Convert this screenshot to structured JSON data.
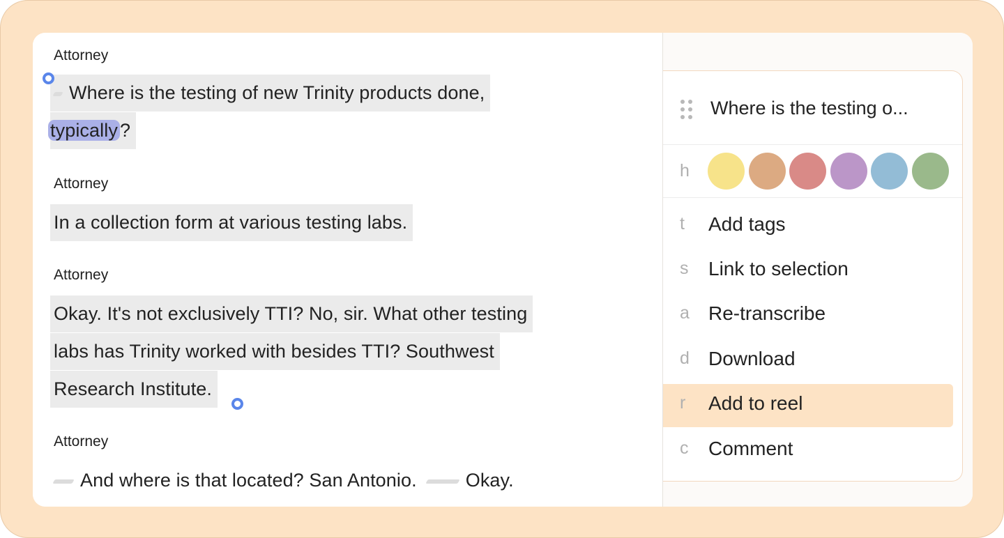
{
  "transcript": {
    "blocks": [
      {
        "speaker": "Attorney",
        "line1": "Where is the testing of new Trinity products done,",
        "highlight": "typically",
        "after_highlight": "?"
      },
      {
        "speaker": "Attorney",
        "line1": "In a collection form at various testing labs."
      },
      {
        "speaker": "Attorney",
        "line1": "Okay. It's not exclusively TTI? No, sir. What other testing",
        "line2": "labs has Trinity worked with besides TTI? Southwest",
        "line3": "Research Institute."
      },
      {
        "speaker": "Attorney",
        "part1": "And where is that located? San Antonio.",
        "part2": "Okay."
      }
    ]
  },
  "menu": {
    "title": "Where is the testing o...",
    "color_key": "h",
    "colors": [
      "#f7e38a",
      "#dcaa82",
      "#d98a87",
      "#bb96c8",
      "#93bcd6",
      "#9ab98b"
    ],
    "items": [
      {
        "key": "t",
        "label": "Add tags"
      },
      {
        "key": "s",
        "label": "Link to selection"
      },
      {
        "key": "a",
        "label": "Re-transcribe"
      },
      {
        "key": "d",
        "label": "Download"
      },
      {
        "key": "r",
        "label": "Add to reel"
      },
      {
        "key": "c",
        "label": "Comment"
      }
    ],
    "active_item": "Add to reel"
  }
}
